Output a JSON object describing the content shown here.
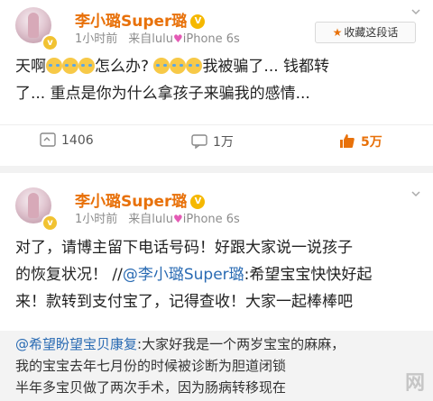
{
  "post1": {
    "username": "李小璐Super璐",
    "crown_badge": "V",
    "time": "1小时前",
    "source_prefix": "来自lulu",
    "source_device": "iPhone 6s",
    "favorite_label": "收藏这段话",
    "text_line1_a": "天啊",
    "text_line1_b": "怎么办?",
    "text_line1_c": "我被骗了... 钱都转",
    "text_line2": "了... 重点是你为什么拿孩子来骗我的感情...",
    "reposts": "1406",
    "comments": "1万",
    "likes": "5万"
  },
  "post2": {
    "username": "李小璐Super璐",
    "crown_badge": "V",
    "time": "1小时前",
    "source_prefix": "来自lulu",
    "source_device": "iPhone 6s",
    "text_line1": "对了，请博主留下电话号码！好跟大家说一说孩子",
    "text_line2_a": "的恢复状况！ //",
    "text_line2_mention": "@李小璐Super璐",
    "text_line2_b": ":希望宝宝快快好起",
    "text_line3": "来！款转到支付宝了，记得查收！大家一起棒棒吧",
    "repost_mention": "@希望盼望宝贝康复",
    "repost_line1": ":大家好我是一个两岁宝宝的麻麻，",
    "repost_line2": "我的宝宝去年七月份的时候被诊断为胆道闭锁",
    "repost_line3": "半年多宝贝做了两次手术，因为肠病转移现在"
  },
  "watermark": "网"
}
